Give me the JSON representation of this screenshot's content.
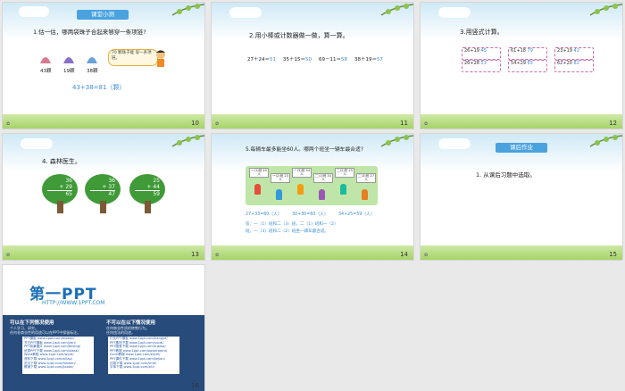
{
  "slides": [
    {
      "id": 10,
      "number": "10",
      "badge": "课堂小测",
      "question": "1.估一估，哪两袋珠子合起来够穿一条项链?",
      "bags": [
        "43颗",
        "19颗",
        "38颗"
      ],
      "bubble": "70 颗珠子能 穿一条项链。",
      "answer": "43+38=81（颗）"
    },
    {
      "id": 11,
      "number": "11",
      "question": "2.用小棒或计数器做一做，算一算。",
      "eq_lhs": [
        "27＋24＝",
        "35＋15＝",
        "69－11＝",
        "38＋19＝"
      ],
      "eq_ans": [
        "51",
        "50",
        "58",
        "57"
      ]
    },
    {
      "id": 12,
      "number": "12",
      "question": "3.用竖式计算。",
      "calcs": [
        {
          "a": "26",
          "b": "19",
          "res": "45"
        },
        {
          "a": "61",
          "b": "18",
          "res": "79"
        },
        {
          "a": "23",
          "b": "19",
          "res": "42"
        },
        {
          "a": "26",
          "b": "28",
          "res": "53"
        },
        {
          "a": "54",
          "b": "29",
          "res": "65"
        },
        {
          "a": "62",
          "b": "20",
          "res": "82"
        }
      ]
    },
    {
      "id": 13,
      "number": "13",
      "question": "4. 森林医生。",
      "trees": [
        {
          "a": "36",
          "b": "+ 29",
          "res": "65"
        },
        {
          "a": "36",
          "b": "+ 37",
          "res": "47"
        },
        {
          "a": "25",
          "b": "+ 44",
          "res": "59"
        }
      ]
    },
    {
      "id": 14,
      "number": "14",
      "question": "5.每辆车最多能坐60人。哪两个班坐一辆车最合适?",
      "signs": [
        "一(1)班 40人",
        "一(2)班 23人",
        "一(3)班 34人",
        "二(1)班 33人",
        "二(2)班 25人",
        "二(3)班 27人"
      ],
      "sums": [
        "27+33=60（人）",
        "30+30=60（人）",
        "34+25=59（人）"
      ],
      "answer1": "答：一（1）班和二（3）班，二（1）班和一（2）",
      "answer2": "班，一（3）班和二（2）班坐一辆车最合适。"
    },
    {
      "id": 15,
      "number": "15",
      "badge": "课后作业",
      "question": "1. 从课后习题中选取。"
    },
    {
      "id": 16,
      "number": "16",
      "title": "第一PPT",
      "url": "HTTP://WWW.1PPT.COM",
      "can_title": "可以在下列情况使用",
      "can_lines": [
        "个人学习、研究。",
        "任何非商业性的用途可以在PPT中保留标注。"
      ],
      "cannot_title": "不可以在以下情况使用",
      "cannot_lines": [
        "任何商业性质的转售行为。",
        "任何违法的用途。"
      ],
      "left_links": [
        "PPT模板 www.1ppt.com/moban/",
        "节日PPT模板 www.1ppt.com/jieri/",
        "PPT背景图片 www.1ppt.com/beijing/",
        "优秀PPT下载 www.1ppt.com/xiazai/",
        "Word教程 www.1ppt.com/word/",
        "资料下载 www.1ppt.com/ziliao/",
        "范文下载 www.1ppt.com/fanwen/",
        "教案下载 www.1ppt.com/jiaoan/"
      ],
      "right_links": [
        "行业PPT模板 www.1ppt.com/hangye/",
        "PPT素材下载 www.1ppt.com/sucai/",
        "PPT图表下载 www.1ppt.com/tubiao/",
        "PPT教程 www.1ppt.com/powerpoint/",
        "Excel教程 www.1ppt.com/excel/",
        "PPT课件下载 www.1ppt.com/kejian/",
        "试卷下载 www.1ppt.com/shiti/",
        "字体下载 www.1ppt.com/ziti/"
      ]
    }
  ],
  "colors": {
    "accent": "#4aa3df",
    "answer": "#3b8ed6",
    "tree": "#3f9a37",
    "panel": "#274b7a"
  }
}
